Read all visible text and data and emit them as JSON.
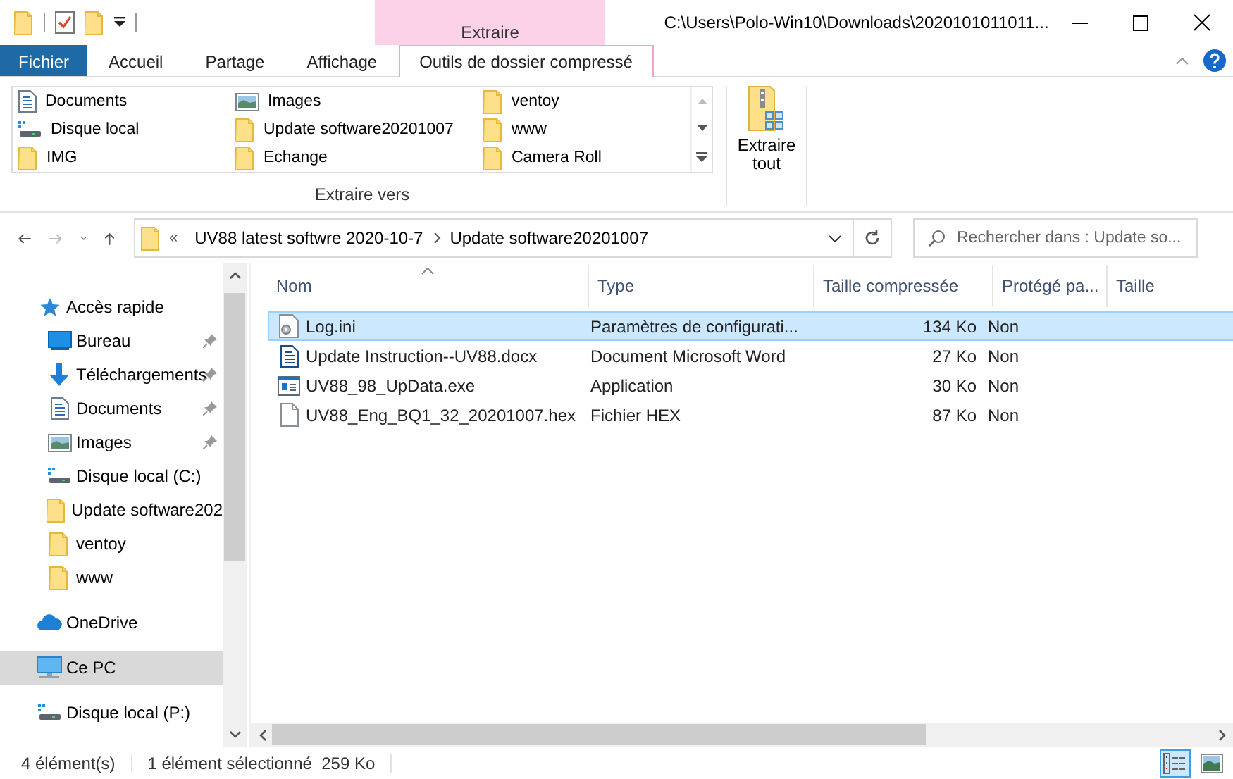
{
  "window": {
    "title": "C:\\Users\\Polo-Win10\\Downloads\\2020101011011...",
    "contextual_group": "Extraire"
  },
  "ribbon_tabs": [
    {
      "label": "Fichier",
      "kind": "file",
      "selected": false
    },
    {
      "label": "Accueil",
      "kind": "tab",
      "selected": false
    },
    {
      "label": "Partage",
      "kind": "tab",
      "selected": false
    },
    {
      "label": "Affichage",
      "kind": "tab",
      "selected": false
    },
    {
      "label": "Outils de dossier compressé",
      "kind": "contextual",
      "selected": true
    }
  ],
  "extract_to": {
    "group_label": "Extraire vers",
    "items": [
      {
        "label": "Documents",
        "kind": "documents"
      },
      {
        "label": "Disque local",
        "kind": "drive"
      },
      {
        "label": "IMG",
        "kind": "folder"
      },
      {
        "label": "Images",
        "kind": "pictures"
      },
      {
        "label": "Update software20201007",
        "kind": "folder"
      },
      {
        "label": "Echange",
        "kind": "folder"
      },
      {
        "label": "ventoy",
        "kind": "folder"
      },
      {
        "label": "www",
        "kind": "folder"
      },
      {
        "label": "Camera Roll",
        "kind": "folder"
      }
    ]
  },
  "extract_all": {
    "label": "Extraire tout"
  },
  "address": {
    "overflow": "«",
    "path": [
      "UV88 latest softwre 2020-10-7",
      "Update software20201007"
    ]
  },
  "search": {
    "placeholder": "Rechercher dans : Update so..."
  },
  "nav": [
    {
      "label": "Accès rapide",
      "kind": "quick",
      "selected": false,
      "children": [
        {
          "label": "Bureau",
          "kind": "desktop",
          "pinned": true,
          "selected": false
        },
        {
          "label": "Téléchargements",
          "kind": "downloads",
          "pinned": true,
          "selected": false
        },
        {
          "label": "Documents",
          "kind": "documents",
          "pinned": true,
          "selected": false
        },
        {
          "label": "Images",
          "kind": "pictures",
          "pinned": true,
          "selected": false
        },
        {
          "label": "Disque local (C:)",
          "kind": "drive",
          "pinned": false,
          "selected": false
        },
        {
          "label": "Update software202",
          "kind": "folder",
          "pinned": false,
          "selected": false
        },
        {
          "label": "ventoy",
          "kind": "folder",
          "pinned": false,
          "selected": false
        },
        {
          "label": "www",
          "kind": "folder",
          "pinned": false,
          "selected": false
        }
      ]
    },
    {
      "label": "OneDrive",
      "kind": "onedrive",
      "selected": false
    },
    {
      "label": "Ce PC",
      "kind": "pc",
      "selected": true
    },
    {
      "label": "Disque local (P:)",
      "kind": "drive",
      "selected": false
    }
  ],
  "columns": [
    {
      "label": "Nom",
      "sorted": true
    },
    {
      "label": "Type",
      "sorted": false
    },
    {
      "label": "Taille compressée",
      "sorted": false
    },
    {
      "label": "Protégé pa...",
      "sorted": false
    },
    {
      "label": "Taille",
      "sorted": false
    }
  ],
  "rows": [
    {
      "name": "Log.ini",
      "kind": "settings",
      "type": "Paramètres de configurati...",
      "compressed_size": "134 Ko",
      "protected": "Non",
      "selected": true
    },
    {
      "name": "Update Instruction--UV88.docx",
      "kind": "word",
      "type": "Document Microsoft Word",
      "compressed_size": "27 Ko",
      "protected": "Non",
      "selected": false
    },
    {
      "name": "UV88_98_UpData.exe",
      "kind": "exe",
      "type": "Application",
      "compressed_size": "30 Ko",
      "protected": "Non",
      "selected": false
    },
    {
      "name": "UV88_Eng_BQ1_32_20201007.hex",
      "kind": "file",
      "type": "Fichier HEX",
      "compressed_size": "87 Ko",
      "protected": "Non",
      "selected": false
    }
  ],
  "status_bar": {
    "count": "4 élément(s)",
    "selection": "1 élément sélectionné  259 Ko"
  },
  "view_buttons": [
    {
      "kind": "details",
      "selected": true
    },
    {
      "kind": "large_icons",
      "selected": false
    }
  ]
}
